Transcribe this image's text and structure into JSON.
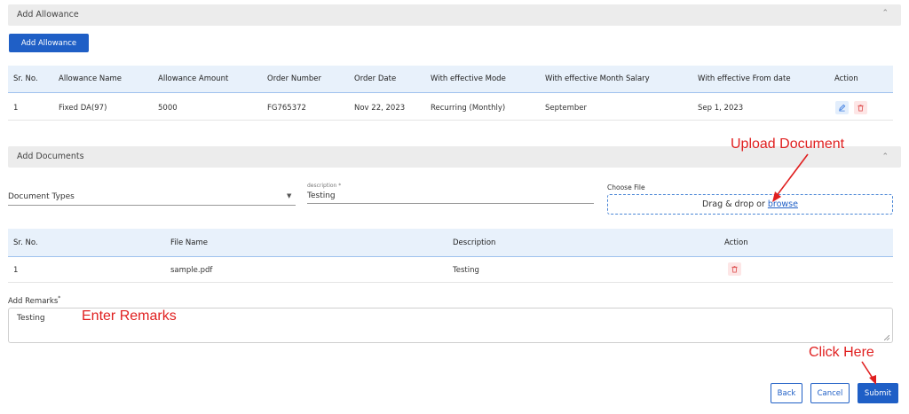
{
  "allowance_section": {
    "title": "Add Allowance",
    "add_button": "Add Allowance",
    "columns": [
      "Sr. No.",
      "Allowance Name",
      "Allowance Amount",
      "Order Number",
      "Order Date",
      "With effective Mode",
      "With effective Month Salary",
      "With effective From date",
      "Action"
    ],
    "rows": [
      {
        "sr": "1",
        "name": "Fixed DA(97)",
        "amount": "5000",
        "order_number": "FG765372",
        "order_date": "Nov 22, 2023",
        "mode": "Recurring (Monthly)",
        "month": "September",
        "from_date": "Sep 1, 2023"
      }
    ]
  },
  "documents_section": {
    "title": "Add Documents",
    "document_types_placeholder": "Document Types",
    "description_label": "description *",
    "description_value": "Testing",
    "choose_file_label": "Choose File",
    "dropzone_text": "Drag & drop or",
    "dropzone_link": "browse",
    "columns": [
      "Sr. No.",
      "File Name",
      "Description",
      "Action"
    ],
    "rows": [
      {
        "sr": "1",
        "file_name": "sample.pdf",
        "description": "Testing"
      }
    ]
  },
  "remarks": {
    "label": "Add Remarks",
    "required_mark": "*",
    "value": "Testing"
  },
  "footer": {
    "back": "Back",
    "cancel": "Cancel",
    "submit": "Submit"
  },
  "annotations": {
    "upload": "Upload Document",
    "remarks": "Enter Remarks",
    "click": "Click Here"
  },
  "colors": {
    "primary": "#1f5fc6",
    "annotation": "#e02020",
    "danger": "#e05a5a"
  }
}
